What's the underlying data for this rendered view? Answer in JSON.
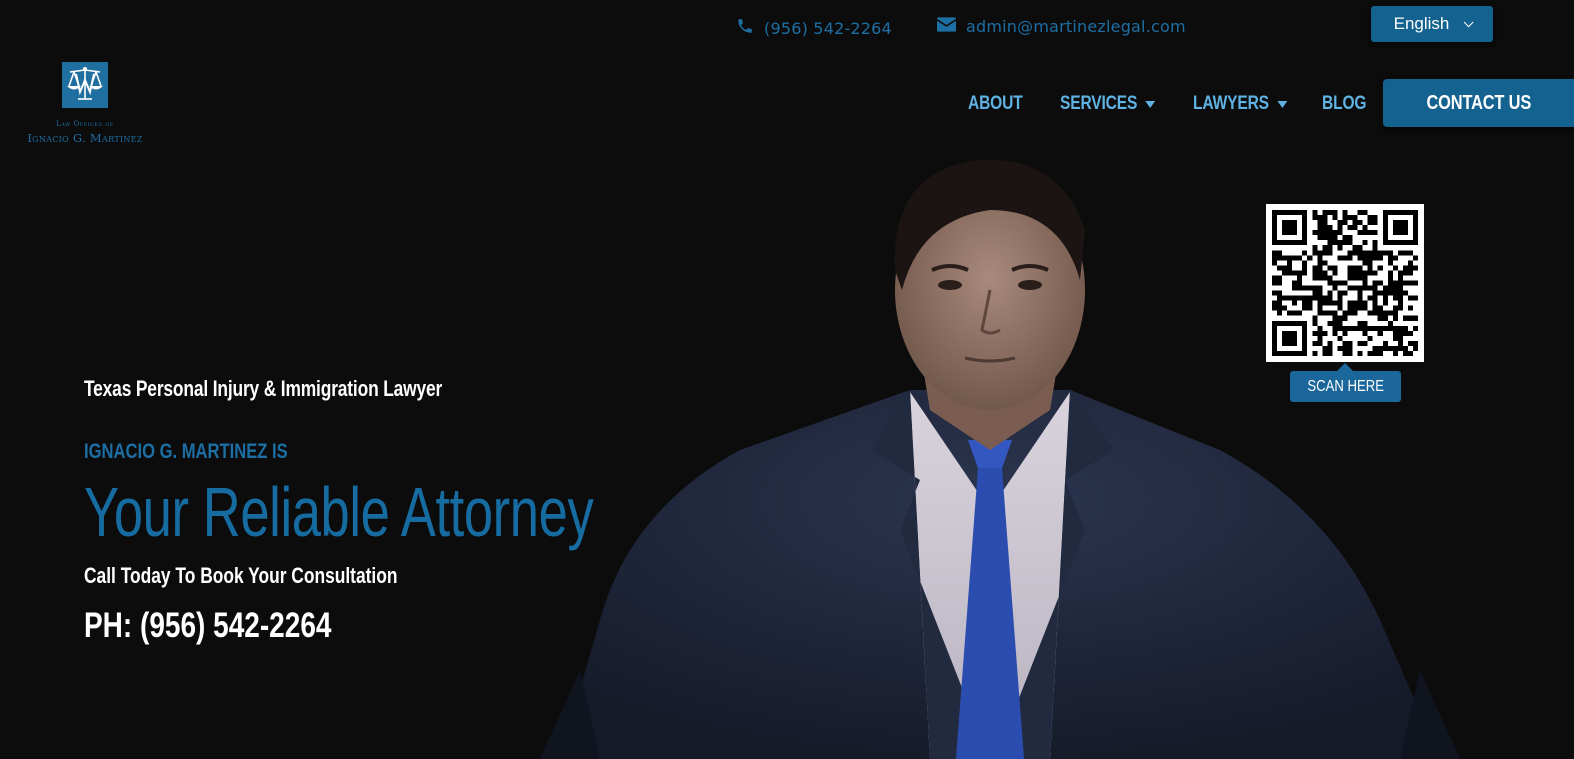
{
  "topbar": {
    "phone": "(956) 542-2264",
    "phone_icon": "phone-icon",
    "email": "admin@martinezlegal.com",
    "email_icon": "envelope-icon"
  },
  "language": {
    "selected": "English"
  },
  "logo": {
    "line1": "Law Offices of",
    "line2": "Ignacio G. Martinez"
  },
  "nav": {
    "items": [
      {
        "label": "ABOUT"
      },
      {
        "label": "SERVICES"
      },
      {
        "label": "LAWYERS"
      },
      {
        "label": "BLOG"
      }
    ],
    "contact_label": "CONTACT US"
  },
  "hero": {
    "tagline": "Texas Personal Injury & Immigration Lawyer",
    "pretitle": "IGNACIO G. MARTINEZ IS",
    "title": "Your Reliable Attorney",
    "subtitle": "Call Today To Book Your Consultation",
    "phone": "PH: (956) 542-2264"
  },
  "qr": {
    "label": "SCAN HERE"
  },
  "colors": {
    "background": "#0c0c0d",
    "brand_blue": "#13628f",
    "accent_text": "#1d6fa3",
    "nav_text": "#5fb2e2"
  }
}
